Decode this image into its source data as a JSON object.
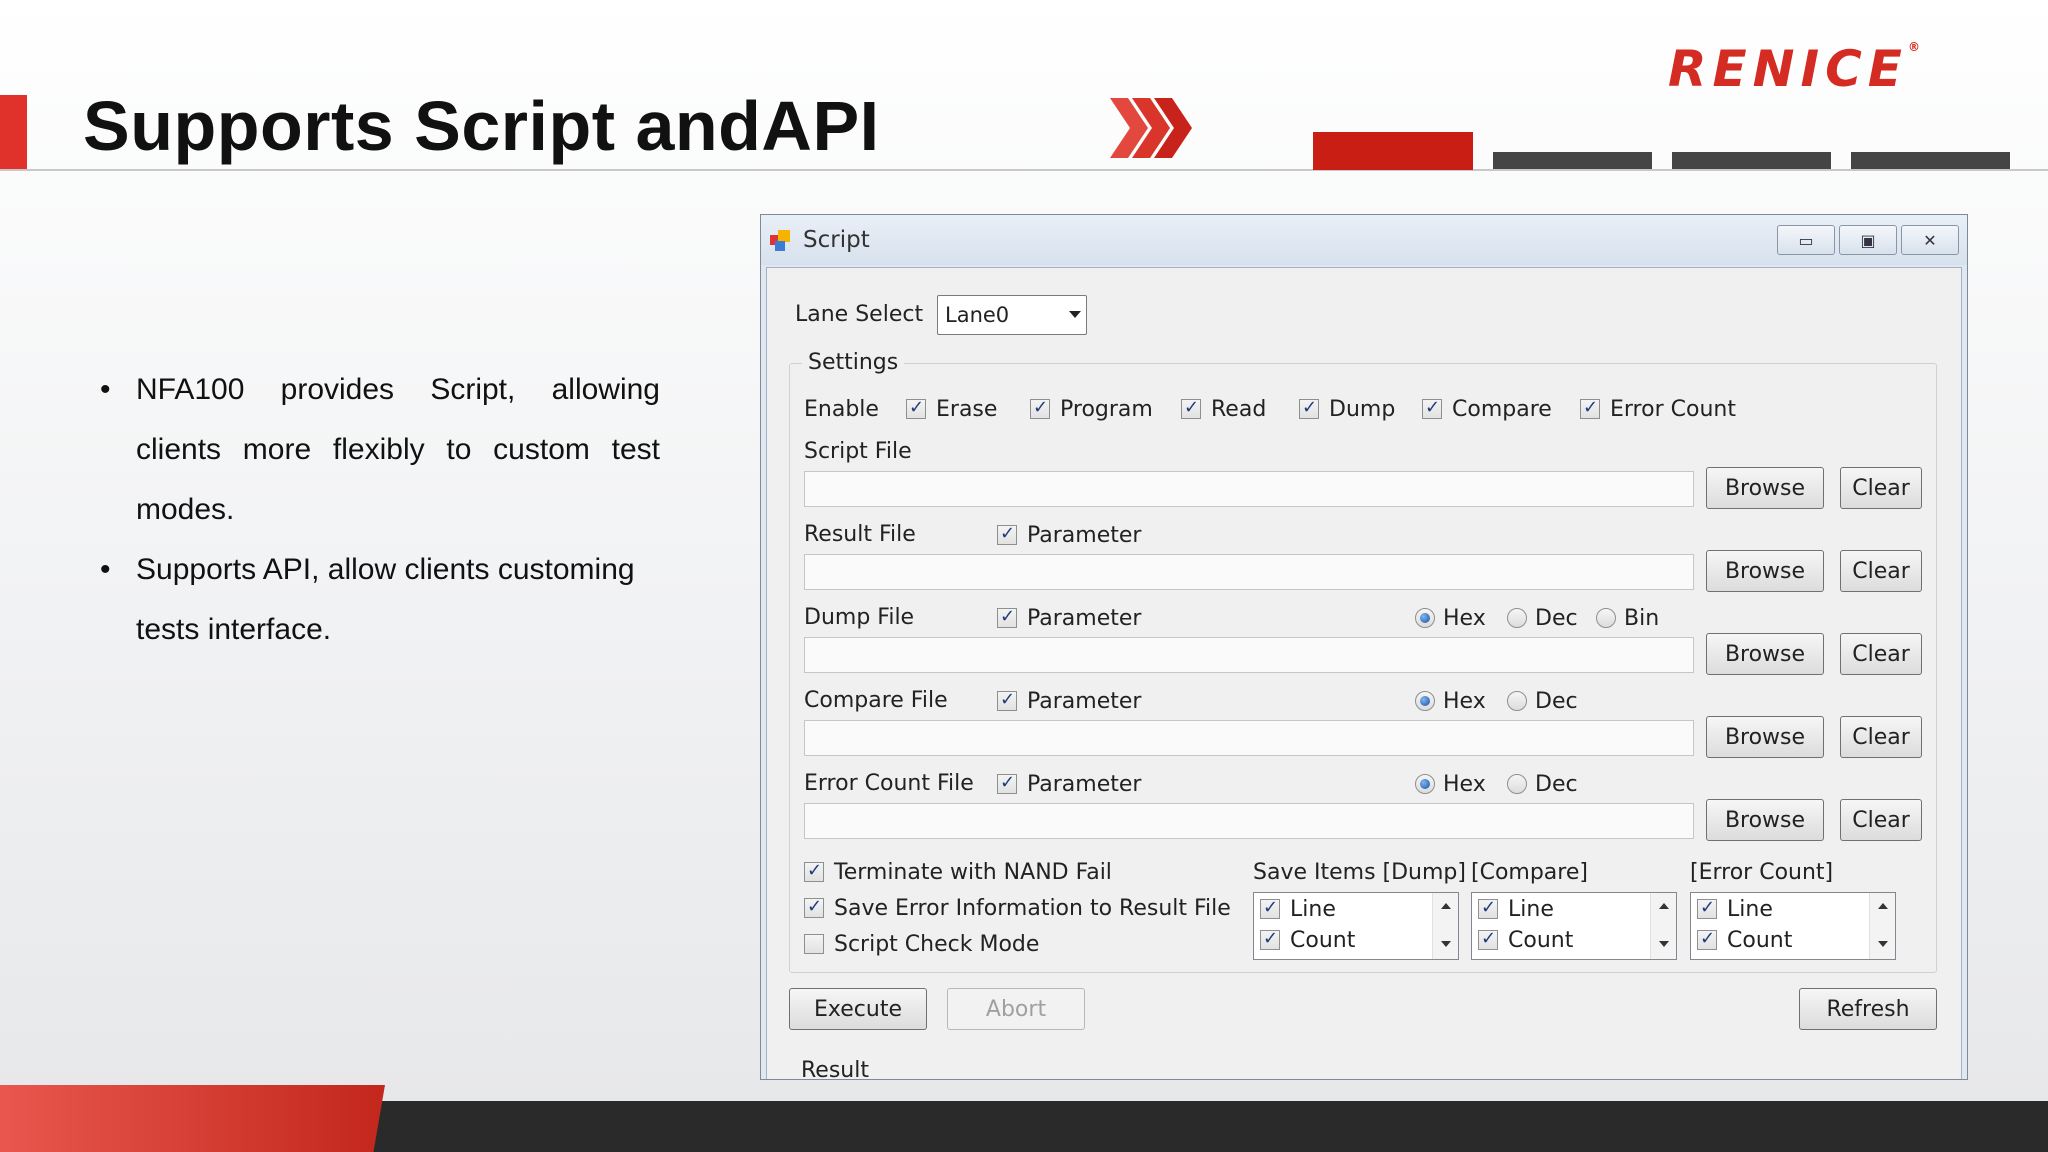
{
  "slide": {
    "title": "Supports Script andAPI",
    "logo": "RENICE",
    "bullets": [
      "NFA100 provides Script, allowing clients more flexibly to custom test modes.",
      "Supports API, allow clients customing tests interface."
    ]
  },
  "window": {
    "title": "Script",
    "minimize_icon": "minimize-icon",
    "maximize_icon": "restore-icon",
    "close_icon": "close-icon"
  },
  "lane": {
    "label": "Lane Select",
    "value": "Lane0"
  },
  "settings": {
    "title": "Settings",
    "enable_label": "Enable",
    "enable_options": [
      {
        "label": "Erase",
        "checked": true
      },
      {
        "label": "Program",
        "checked": true
      },
      {
        "label": "Read",
        "checked": true
      },
      {
        "label": "Dump",
        "checked": true
      },
      {
        "label": "Compare",
        "checked": true
      },
      {
        "label": "Error Count",
        "checked": true
      }
    ],
    "script_file": {
      "label": "Script File",
      "value": ""
    },
    "result_file": {
      "label": "Result File",
      "param_label": "Parameter",
      "param_checked": true,
      "value": ""
    },
    "dump_file": {
      "label": "Dump File",
      "param_label": "Parameter",
      "param_checked": true,
      "value": "",
      "formats": [
        "Hex",
        "Dec",
        "Bin"
      ],
      "selected": "Hex"
    },
    "compare_file": {
      "label": "Compare File",
      "param_label": "Parameter",
      "param_checked": true,
      "value": "",
      "formats": [
        "Hex",
        "Dec"
      ],
      "selected": "Hex"
    },
    "error_count_file": {
      "label": "Error Count File",
      "param_label": "Parameter",
      "param_checked": true,
      "value": "",
      "formats": [
        "Hex",
        "Dec"
      ],
      "selected": "Hex"
    },
    "browse_label": "Browse",
    "clear_label": "Clear",
    "options": [
      {
        "label": "Terminate with NAND Fail",
        "checked": true
      },
      {
        "label": "Save Error Information to Result File",
        "checked": true
      },
      {
        "label": "Script Check Mode",
        "checked": false
      }
    ],
    "save_items": {
      "dump_title": "Save Items [Dump]",
      "compare_title": "[Compare]",
      "error_title": "[Error Count]",
      "items": [
        {
          "label": "Line",
          "checked": true
        },
        {
          "label": "Count",
          "checked": true
        }
      ]
    }
  },
  "actions": {
    "execute": "Execute",
    "abort": "Abort",
    "refresh": "Refresh"
  },
  "result": {
    "title": "Result"
  },
  "colors": {
    "brand_red": "#d42b22",
    "accent_red": "#c81e14",
    "dark_bar": "#454545"
  }
}
